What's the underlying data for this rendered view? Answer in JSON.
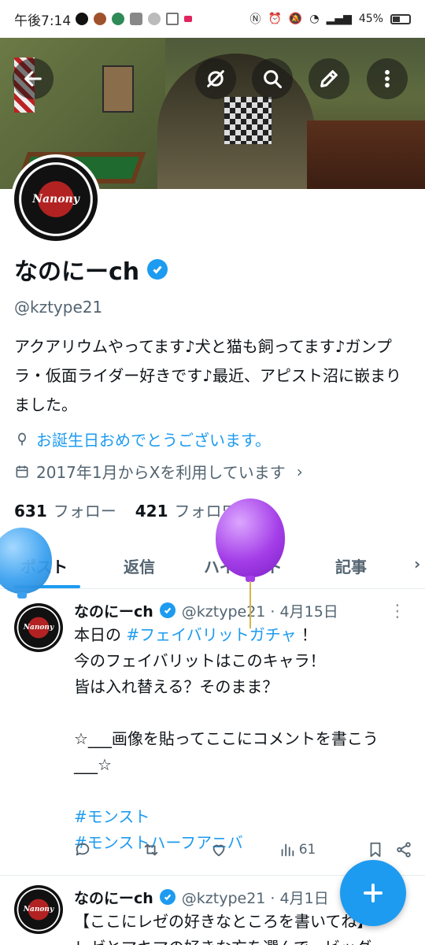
{
  "status_bar": {
    "time": "午後7:14",
    "battery": "45%"
  },
  "profile": {
    "name": "なのにーch",
    "handle": "@kztype21",
    "bio": "アクアリウムやってます♪犬と猫も飼ってます♪ガンプラ・仮面ライダー好きです♪最近、アピスト沼に嵌まりました。",
    "birthday": "お誕生日おめでとうございます。",
    "joined": "2017年1月からXを利用しています",
    "following_count": "631",
    "following_label": "フォロー",
    "followers_count": "421",
    "followers_label": "フォロワー",
    "avatar_text": "Nanony"
  },
  "tabs": [
    "ポスト",
    "返信",
    "ハイライト",
    "記事"
  ],
  "posts": [
    {
      "name": "なのにーch",
      "handle_date": "@kztype21 · 4月15日",
      "line1_a": "本日の",
      "line1_tag": "#フェイバリットガチャ",
      "line1_b": "！",
      "line2": "今のフェイバリットはこのキャラ！",
      "line3": "皆は入れ替える？そのまま？",
      "line4": "☆___画像を貼ってここにコメントを書こう___☆",
      "tag1": "#モンスト",
      "tag2": "#モンストハーフアニバ",
      "views": "61"
    },
    {
      "name": "なのにーch",
      "handle_date": "@kztype21 · 4月1日",
      "line1": "【ここにレゼの好きなところを書いてね】",
      "line2": "レゼとマキマの好きな方を選んで、ビッグ"
    }
  ],
  "colors": {
    "accent": "#1d9bf0",
    "balloon_blue": "#3aa0ef",
    "balloon_purple": "#a43ee8"
  }
}
